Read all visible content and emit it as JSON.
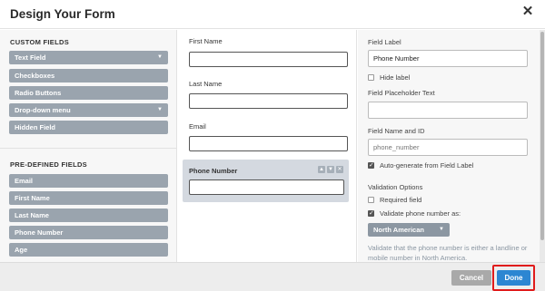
{
  "dialog": {
    "title": "Design Your Form",
    "close_icon": "close-icon"
  },
  "custom_fields": {
    "heading": "CUSTOM FIELDS",
    "items": [
      {
        "label": "Text Field",
        "has_caret": true
      },
      {
        "label": "Checkboxes",
        "has_caret": false
      },
      {
        "label": "Radio Buttons",
        "has_caret": false
      },
      {
        "label": "Drop-down menu",
        "has_caret": true
      },
      {
        "label": "Hidden Field",
        "has_caret": false
      }
    ]
  },
  "predefined_fields": {
    "heading": "PRE-DEFINED FIELDS",
    "items": [
      {
        "label": "Email"
      },
      {
        "label": "First Name"
      },
      {
        "label": "Last Name"
      },
      {
        "label": "Phone Number"
      },
      {
        "label": "Age"
      }
    ]
  },
  "form_preview": {
    "fields": [
      {
        "label": "First Name",
        "value": ""
      },
      {
        "label": "Last Name",
        "value": ""
      },
      {
        "label": "Email",
        "value": ""
      }
    ],
    "selected_field": {
      "label": "Phone Number",
      "value": ""
    }
  },
  "settings": {
    "field_label_title": "Field Label",
    "field_label_value": "Phone Number",
    "hide_label": {
      "label": "Hide label",
      "checked": false
    },
    "placeholder_title": "Field Placeholder Text",
    "placeholder_value": "",
    "name_id_title": "Field Name and ID",
    "name_id_placeholder": "phone_number",
    "auto_generate": {
      "label": "Auto-generate from Field Label",
      "checked": true
    },
    "validation_title": "Validation Options",
    "required": {
      "label": "Required field",
      "checked": false
    },
    "validate_phone": {
      "label": "Validate phone number as:",
      "checked": true
    },
    "phone_format": "North American",
    "help_text": "Validate that the phone number is either a landline or mobile number in North America."
  },
  "footer": {
    "cancel_label": "Cancel",
    "done_label": "Done"
  },
  "colors": {
    "accent": "#2c86d2",
    "field_button": "#9aa4ae",
    "highlight_outline": "#e01b1b"
  }
}
